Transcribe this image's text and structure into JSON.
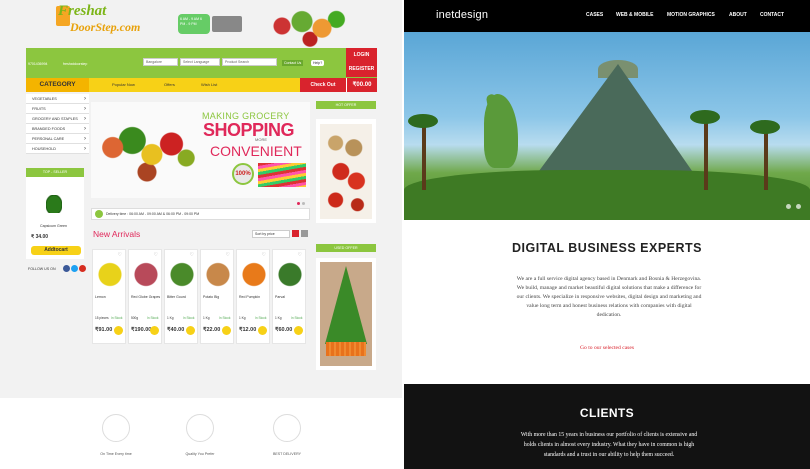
{
  "left_site": {
    "logo_line1": "Freshat",
    "logo_line2": "DoorStep.com",
    "delivery_times": "6 AM - 9 AM\n6 PM - 9 PM",
    "topbar": {
      "phone": "9701436994",
      "email": "freshatdoorstep",
      "location": "Bangalore",
      "language": "Select Language",
      "search_placeholder": "Product Search",
      "contact": "Contact Us",
      "help": "Help?",
      "login": "LOGIN",
      "register": "REGISTER"
    },
    "menu": {
      "category": "CATEGORY",
      "popular": "Popular Now",
      "offers": "Offers",
      "wishlist": "Wish List",
      "checkout": "Check Out",
      "cart_total": "₹00.00"
    },
    "categories": [
      "VEGETABLES",
      "FRUITS",
      "GROCERY AND STAPLES",
      "BRANDED FOODS",
      "PERSONAL CARE",
      "HOUSEHOLD"
    ],
    "top_seller": {
      "heading": "TOP - SELLER",
      "name": "Capsicum Green",
      "price": "₹ 34.00",
      "add": "Addtocart",
      "follow": "FOLLOW US ON"
    },
    "banner": {
      "line1": "MAKING GROCERY",
      "line2": "SHOPPING",
      "line3": "MORE",
      "line4": "CONVENIENT",
      "badge": "100%"
    },
    "delivery_bar": "Delivery time : 06:00 AM - 09:00 AM & 06:00 PM - 09:00 PM",
    "new_arrivals": "New Arrivals",
    "sort": "Sort by price",
    "products": [
      {
        "name": "Lemon",
        "qty": "15 pieces",
        "stock": "In Stock",
        "price": "₹91.00",
        "color": "#e8d21a"
      },
      {
        "name": "Red Globe Grapes",
        "qty": "500g",
        "stock": "In Stock",
        "price": "₹190.00",
        "color": "#b84a5a"
      },
      {
        "name": "Bitter Gourd",
        "qty": "1 Kg",
        "stock": "In Stock",
        "price": "₹40.00",
        "color": "#4a8a2a"
      },
      {
        "name": "Potato Big",
        "qty": "1 Kg",
        "stock": "In Stock",
        "price": "₹22.00",
        "color": "#c8884a"
      },
      {
        "name": "Red Pumpkin",
        "qty": "1 Kg",
        "stock": "In Stock",
        "price": "₹12.00",
        "color": "#e87a1a"
      },
      {
        "name": "Parval",
        "qty": "1 Kg",
        "stock": "In Stock",
        "price": "₹60.00",
        "color": "#3a7a2a"
      }
    ],
    "hot_offer": "HOT OFFER",
    "used_offer": "USED OFFER",
    "features": [
      "On Time Every time",
      "Quality You Prefer",
      "BEST DELIVERY"
    ]
  },
  "right_site": {
    "logo": "inetdesign",
    "nav": [
      "CASES",
      "WEB & MOBILE",
      "MOTION GRAPHICS",
      "ABOUT",
      "CONTACT"
    ],
    "headline": "DIGITAL BUSINESS EXPERTS",
    "paragraph": "We are a full service digital agency based in Denmark and Bosnia & Herzegovina. We build, manage and market beautiful digital solutions that make a difference for our clients. We specialize in responsive websites, digital design and marketing and value long term and honest business relations with companies with digital dedication.",
    "link": "Go to our selected cases",
    "clients_title": "CLIENTS",
    "clients_text": "With more than 15 years in business our portfolio of clients is extensive and holds clients in almost every industry. What they have in common is high standards and a trust in our ability to help them succeed."
  }
}
